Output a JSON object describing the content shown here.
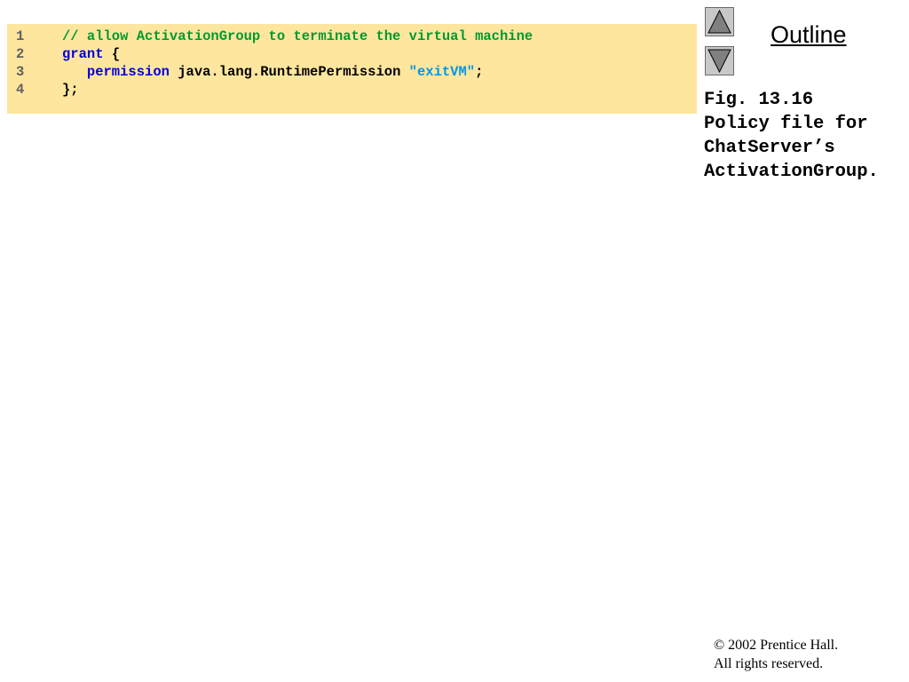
{
  "code": {
    "lines": [
      {
        "number": "1",
        "tokens": [
          {
            "type": "comment",
            "text": "// allow ActivationGroup to terminate the virtual machine"
          }
        ]
      },
      {
        "number": "2",
        "tokens": [
          {
            "type": "keyword",
            "text": "grant"
          },
          {
            "type": "plain",
            "text": " {"
          }
        ]
      },
      {
        "number": "3",
        "tokens": [
          {
            "type": "plain",
            "text": "   "
          },
          {
            "type": "keyword",
            "text": "permission"
          },
          {
            "type": "plain",
            "text": " java.lang.RuntimePermission "
          },
          {
            "type": "string",
            "text": "\"exitVM\""
          },
          {
            "type": "plain",
            "text": ";"
          }
        ]
      },
      {
        "number": "4",
        "tokens": [
          {
            "type": "plain",
            "text": "};"
          }
        ]
      }
    ]
  },
  "nav": {
    "outline_label": "Outline",
    "up_icon": "triangle-up-icon",
    "down_icon": "triangle-down-icon"
  },
  "caption": {
    "lines": [
      "Fig. 13.16",
      "Policy file for",
      "ChatServer’s",
      "ActivationGroup."
    ]
  },
  "footer": {
    "copyright_line1": "© 2002 Prentice Hall.",
    "copyright_line2": "All rights reserved."
  },
  "colors": {
    "code_background": "#ffe69e",
    "comment": "#009a2f",
    "keyword": "#0000dd",
    "string": "#0096e6"
  }
}
